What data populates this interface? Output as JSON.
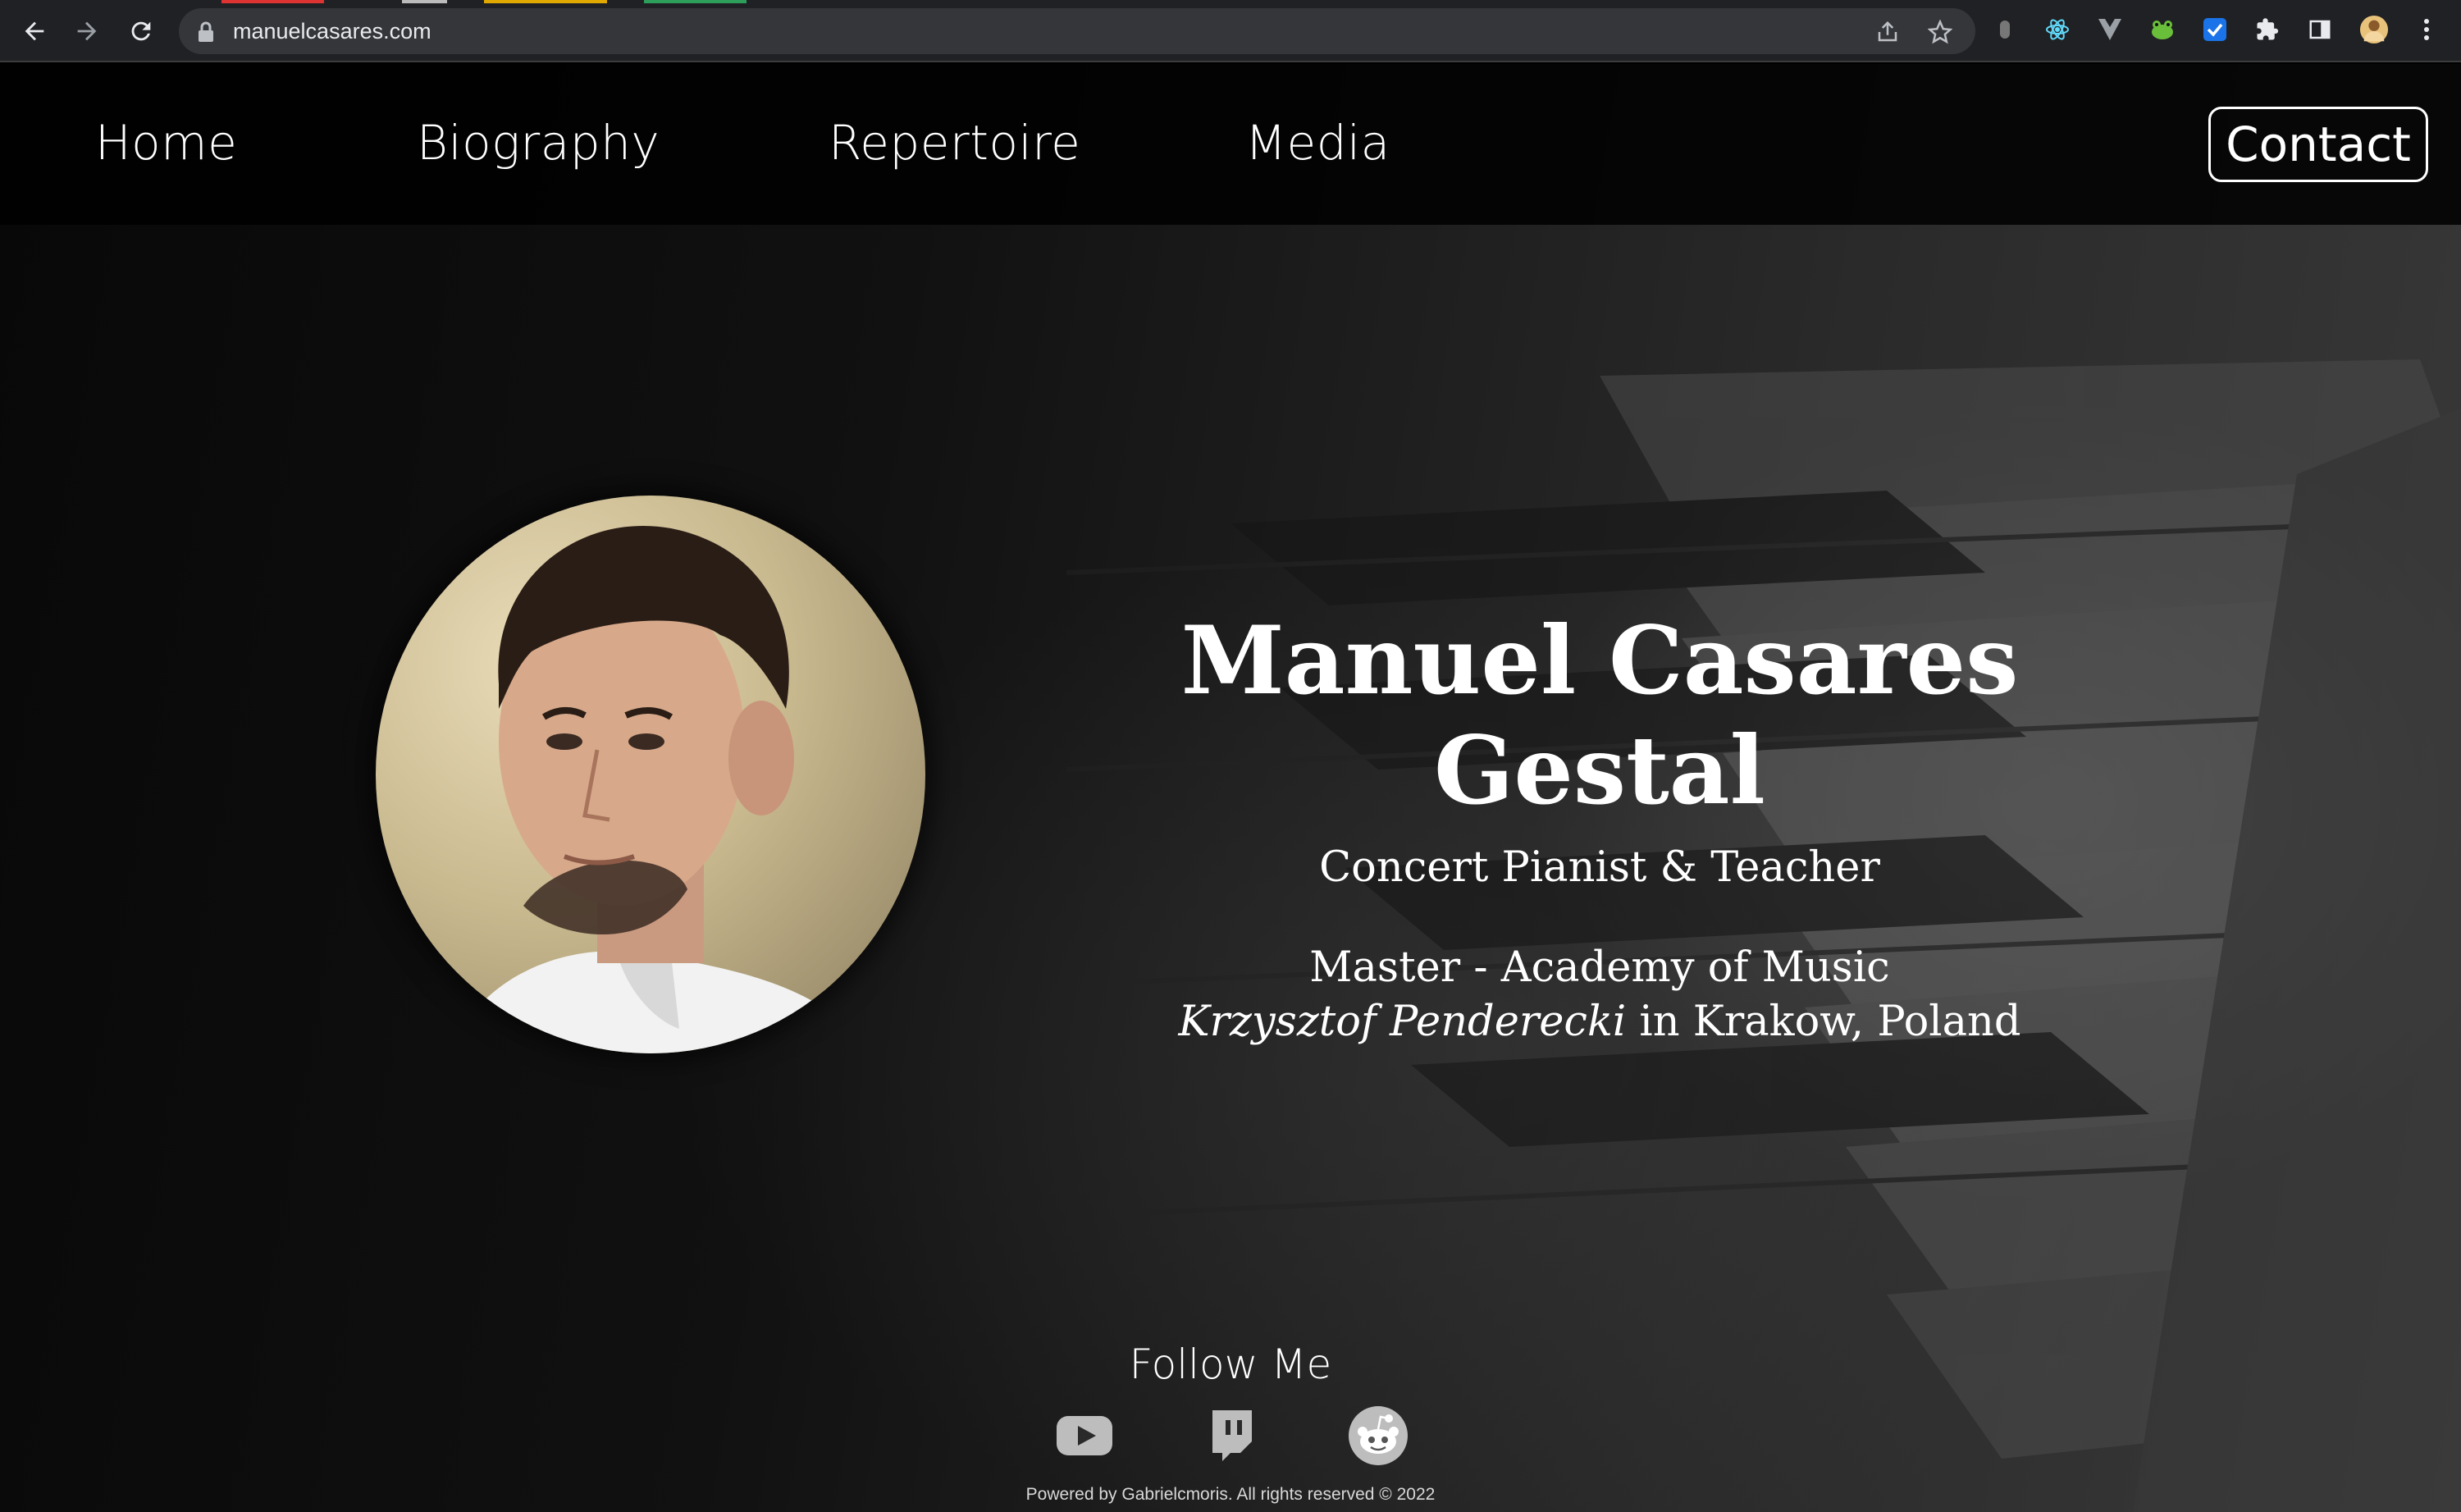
{
  "browser": {
    "url": "manuelcasares.com",
    "icons": [
      "back-arrow-icon",
      "forward-arrow-icon",
      "reload-icon",
      "lock-icon",
      "share-icon",
      "bookmark-star-icon",
      "extension-icons",
      "puzzle-icon",
      "side-panel-icon",
      "profile-avatar",
      "menu-kebab-icon"
    ]
  },
  "nav": {
    "home": "Home",
    "biography": "Biography",
    "repertoire": "Repertoire",
    "media": "Media",
    "contact": "Contact"
  },
  "hero": {
    "name": "Manuel Casares Gestal",
    "role": "Concert Pianist & Teacher",
    "degree_line1": "Master - Academy of Music",
    "degree_italic": "Krzysztof Penderecki",
    "degree_rest": " in Krakow, Poland"
  },
  "follow": {
    "heading": "Follow Me",
    "icons": [
      "youtube-icon",
      "twitch-icon",
      "reddit-icon"
    ]
  },
  "footer": {
    "text": "Powered by Gabrielcmoris. All rights reserved © 2022"
  },
  "colors": {
    "chrome_bg": "#202124",
    "omnibox_bg": "#35363a",
    "page_text": "#ffffff"
  }
}
